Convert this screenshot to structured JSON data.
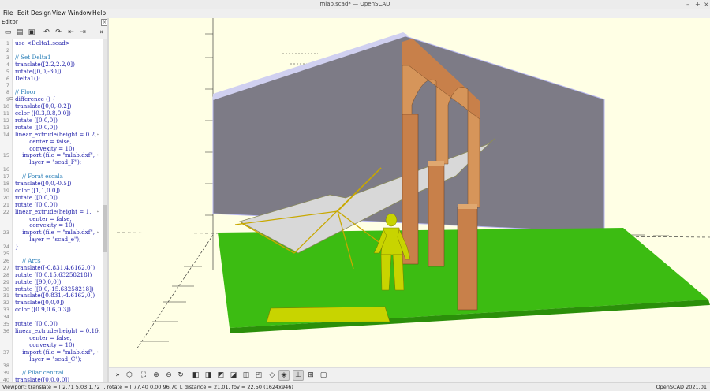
{
  "window": {
    "title": "mlab.scad* — OpenSCAD",
    "controls": [
      "–",
      "+",
      "×"
    ]
  },
  "menu": [
    "File",
    "Edit",
    "Design",
    "View",
    "Window",
    "Help"
  ],
  "editor": {
    "header": "Editor",
    "close": "×",
    "toolbar": [
      {
        "name": "new-file-icon",
        "glyph": "▭"
      },
      {
        "name": "open-file-icon",
        "glyph": "▤"
      },
      {
        "name": "save-file-icon",
        "glyph": "▣"
      },
      {
        "name": "undo-icon",
        "glyph": "↶"
      },
      {
        "name": "redo-icon",
        "glyph": "↷"
      },
      {
        "name": "unindent-icon",
        "glyph": "⇤"
      },
      {
        "name": "indent-icon",
        "glyph": "⇥"
      },
      {
        "name": "expand-toolbar-icon",
        "glyph": "»"
      }
    ],
    "lines": [
      {
        "n": "1",
        "t": "use <Delta1.scad>"
      },
      {
        "n": "2",
        "t": ""
      },
      {
        "n": "3",
        "t": "// Set Delta1"
      },
      {
        "n": "4",
        "t": "translate([2.2,2.2,0])"
      },
      {
        "n": "5",
        "t": "rotate([0,0,-30])"
      },
      {
        "n": "6",
        "t": "Delta1();"
      },
      {
        "n": "7",
        "t": ""
      },
      {
        "n": "8",
        "t": "// Floor"
      },
      {
        "n": "9",
        "t": "difference () {"
      },
      {
        "n": "10",
        "t": "translate([0,0,-0.2])"
      },
      {
        "n": "11",
        "t": "color ([0.3,0.8,0.0])"
      },
      {
        "n": "12",
        "t": "rotate ([0,0,0])"
      },
      {
        "n": "13",
        "t": "rotate ([0,0,0])"
      },
      {
        "n": "14",
        "t": "linear_extrude(height = 0.2,",
        "w": true
      },
      {
        "n": "",
        "t": "        center = false,"
      },
      {
        "n": "",
        "t": "        convexity = 10)"
      },
      {
        "n": "15",
        "t": "    import (file = \"mlab.dxf\",",
        "w": true
      },
      {
        "n": "",
        "t": "        layer = \"scad_F\");"
      },
      {
        "n": "16",
        "t": ""
      },
      {
        "n": "17",
        "t": "    // Forat escala"
      },
      {
        "n": "18",
        "t": "translate([0,0,-0.5])"
      },
      {
        "n": "19",
        "t": "color ([1,1,0.0])"
      },
      {
        "n": "20",
        "t": "rotate ([0,0,0])"
      },
      {
        "n": "21",
        "t": "rotate ([0,0,0])"
      },
      {
        "n": "22",
        "t": "linear_extrude(height = 1,",
        "w": true
      },
      {
        "n": "",
        "t": "        center = false,"
      },
      {
        "n": "",
        "t": "        convexity = 10)"
      },
      {
        "n": "23",
        "t": "    import (file = \"mlab.dxf\",",
        "w": true
      },
      {
        "n": "",
        "t": "        layer = \"scad_e\");"
      },
      {
        "n": "24",
        "t": "}"
      },
      {
        "n": "25",
        "t": ""
      },
      {
        "n": "26",
        "t": "    // Arcs"
      },
      {
        "n": "27",
        "t": "translate([-0.831,4.6162,0])"
      },
      {
        "n": "28",
        "t": "rotate ([0,0,15.63258218])"
      },
      {
        "n": "29",
        "t": "rotate ([90,0,0])"
      },
      {
        "n": "30",
        "t": "rotate ([0,0,-15.63258218])"
      },
      {
        "n": "31",
        "t": "translate([0.831,-4.6162,0])"
      },
      {
        "n": "32",
        "t": "translate([0,0,0])"
      },
      {
        "n": "33",
        "t": "color ([0.9,0.6,0.3])"
      },
      {
        "n": "34",
        "t": ""
      },
      {
        "n": "35",
        "t": "rotate ([0,0,0])"
      },
      {
        "n": "36",
        "t": "linear_extrude(height = 0.16,",
        "w": true
      },
      {
        "n": "",
        "t": "        center = false,"
      },
      {
        "n": "",
        "t": "        convexity = 10)"
      },
      {
        "n": "37",
        "t": "    import (file = \"mlab.dxf\",",
        "w": true
      },
      {
        "n": "",
        "t": "        layer = \"scad_C\");"
      },
      {
        "n": "38",
        "t": ""
      },
      {
        "n": "39",
        "t": "    // Pilar central"
      },
      {
        "n": "40",
        "t": "translate([0,0,0,0])"
      }
    ]
  },
  "viewport": {
    "colors": {
      "background": "#ffffe5",
      "wall": "#7d7b86",
      "floor": "#3cbc12",
      "arch": "#c8804a",
      "figure": "#c8d400",
      "ramp": "#d8d8d8"
    },
    "toolbar": [
      {
        "name": "render-preview-icon",
        "glyph": "»"
      },
      {
        "name": "render-icon",
        "glyph": "⬡"
      },
      {
        "name": "view-all-icon",
        "glyph": "⛶"
      },
      {
        "name": "zoom-in-icon",
        "glyph": "⊕"
      },
      {
        "name": "zoom-out-icon",
        "glyph": "⊖"
      },
      {
        "name": "reset-view-icon",
        "glyph": "↻"
      },
      {
        "name": "view-right-icon",
        "glyph": "◧"
      },
      {
        "name": "view-top-icon",
        "glyph": "◨"
      },
      {
        "name": "view-bottom-icon",
        "glyph": "◩"
      },
      {
        "name": "view-left-icon",
        "glyph": "◪"
      },
      {
        "name": "view-front-icon",
        "glyph": "◫"
      },
      {
        "name": "view-back-icon",
        "glyph": "◰"
      },
      {
        "name": "perspective-icon",
        "glyph": "◇"
      },
      {
        "name": "orthogonal-icon",
        "glyph": "◈"
      },
      {
        "name": "show-axes-icon",
        "glyph": "⊥"
      },
      {
        "name": "show-scale-icon",
        "glyph": "⊞"
      },
      {
        "name": "show-edges-icon",
        "glyph": "▢"
      }
    ]
  },
  "status": {
    "viewport": "Viewport: translate = [ 2.71 5.03 1.72 ], rotate = [ 77.40 0.00 96.70 ], distance = 21.01, fov = 22.50 (1624x946)",
    "version": "OpenSCAD 2021.01"
  }
}
